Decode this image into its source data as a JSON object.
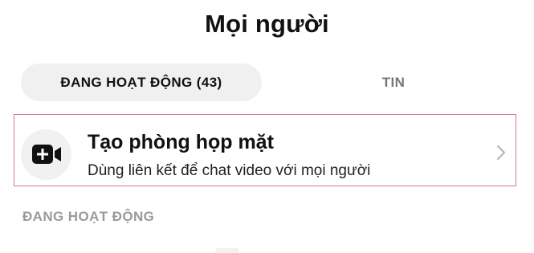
{
  "page_title": "Mọi người",
  "tabs": [
    {
      "label": "ĐANG HOẠT ĐỘNG (43)",
      "active": true
    },
    {
      "label": "TIN",
      "active": false
    }
  ],
  "create_room": {
    "icon": "video-plus-icon",
    "title": "Tạo phòng họp mặt",
    "subtitle": "Dùng liên kết để chat video với mọi người",
    "highlight_color": "#d9758a"
  },
  "section_header": "ĐANG HOẠT ĐỘNG",
  "colors": {
    "text_primary": "#111111",
    "tab_active_bg": "#f0f0f0",
    "tab_inactive_text": "#777777",
    "section_header_text": "#9a9a9a"
  }
}
